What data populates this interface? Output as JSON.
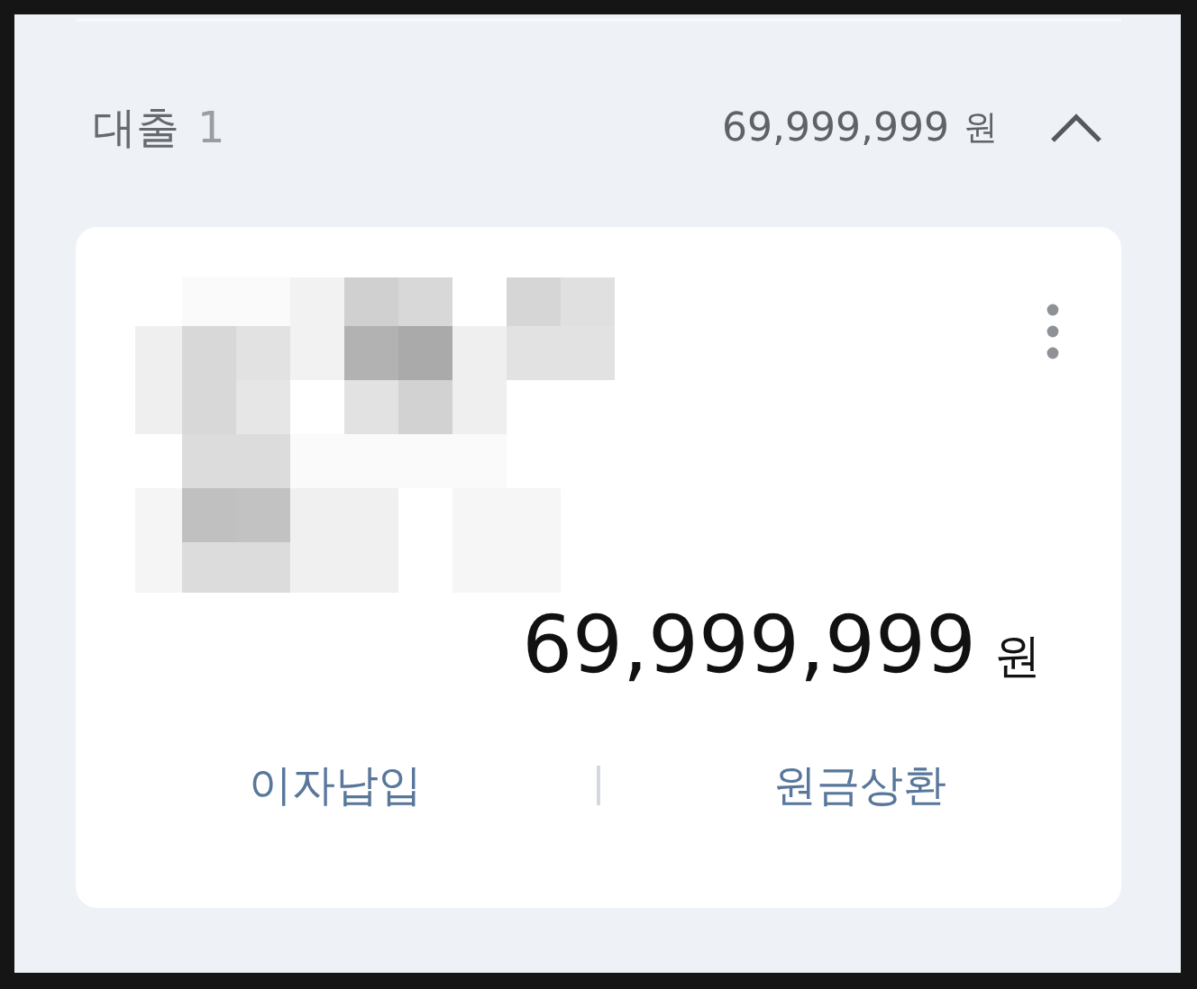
{
  "section": {
    "title": "대출",
    "count": "1",
    "total": "69,999,999",
    "total_unit": "원",
    "expanded": true
  },
  "loan_card": {
    "amount": "69,999,999",
    "unit": "원",
    "actions": [
      {
        "label": "이자납입"
      },
      {
        "label": "원금상환"
      }
    ]
  }
}
